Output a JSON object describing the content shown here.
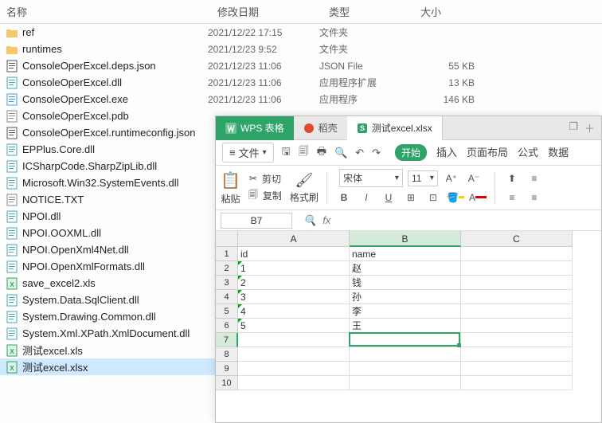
{
  "explorer": {
    "headers": {
      "name": "名称",
      "date": "修改日期",
      "type": "类型",
      "size": "大小"
    },
    "rows": [
      {
        "name": "ref",
        "date": "2021/12/22 17:15",
        "type": "文件夹",
        "size": "",
        "icon": "folder"
      },
      {
        "name": "runtimes",
        "date": "2021/12/23 9:52",
        "type": "文件夹",
        "size": "",
        "icon": "folder"
      },
      {
        "name": "ConsoleOperExcel.deps.json",
        "date": "2021/12/23 11:06",
        "type": "JSON File",
        "size": "55 KB",
        "icon": "json"
      },
      {
        "name": "ConsoleOperExcel.dll",
        "date": "2021/12/23 11:06",
        "type": "应用程序扩展",
        "size": "13 KB",
        "icon": "dll"
      },
      {
        "name": "ConsoleOperExcel.exe",
        "date": "2021/12/23 11:06",
        "type": "应用程序",
        "size": "146 KB",
        "icon": "exe"
      },
      {
        "name": "ConsoleOperExcel.pdb",
        "date": "",
        "type": "",
        "size": "",
        "icon": "file"
      },
      {
        "name": "ConsoleOperExcel.runtimeconfig.json",
        "date": "",
        "type": "",
        "size": "",
        "icon": "json"
      },
      {
        "name": "EPPlus.Core.dll",
        "date": "",
        "type": "",
        "size": "",
        "icon": "dll"
      },
      {
        "name": "ICSharpCode.SharpZipLib.dll",
        "date": "",
        "type": "",
        "size": "",
        "icon": "dll"
      },
      {
        "name": "Microsoft.Win32.SystemEvents.dll",
        "date": "",
        "type": "",
        "size": "",
        "icon": "dll"
      },
      {
        "name": "NOTICE.TXT",
        "date": "",
        "type": "",
        "size": "",
        "icon": "txt"
      },
      {
        "name": "NPOI.dll",
        "date": "",
        "type": "",
        "size": "",
        "icon": "dll"
      },
      {
        "name": "NPOI.OOXML.dll",
        "date": "",
        "type": "",
        "size": "",
        "icon": "dll"
      },
      {
        "name": "NPOI.OpenXml4Net.dll",
        "date": "",
        "type": "",
        "size": "",
        "icon": "dll"
      },
      {
        "name": "NPOI.OpenXmlFormats.dll",
        "date": "",
        "type": "",
        "size": "",
        "icon": "dll"
      },
      {
        "name": "save_excel2.xls",
        "date": "",
        "type": "",
        "size": "",
        "icon": "xls"
      },
      {
        "name": "System.Data.SqlClient.dll",
        "date": "",
        "type": "",
        "size": "",
        "icon": "dll"
      },
      {
        "name": "System.Drawing.Common.dll",
        "date": "",
        "type": "",
        "size": "",
        "icon": "dll"
      },
      {
        "name": "System.Xml.XPath.XmlDocument.dll",
        "date": "",
        "type": "",
        "size": "",
        "icon": "dll"
      },
      {
        "name": "测试excel.xls",
        "date": "",
        "type": "",
        "size": "",
        "icon": "xls"
      },
      {
        "name": "测试excel.xlsx",
        "date": "",
        "type": "",
        "size": "",
        "icon": "xlsx",
        "selected": true
      }
    ]
  },
  "wps": {
    "tabs": {
      "app": "WPS 表格",
      "shell": "稻壳",
      "file": "测试excel.xlsx"
    },
    "menubar": {
      "file": "文件",
      "start": "开始",
      "insert": "插入",
      "layout": "页面布局",
      "formula": "公式",
      "data": "数据"
    },
    "toolbar": {
      "paste": "粘贴",
      "cut": "剪切",
      "copy": "复制",
      "format_painter": "格式刷",
      "font": "宋体",
      "size": "11"
    },
    "namebox": "B7",
    "fx": "fx",
    "grid": {
      "cols": [
        "A",
        "B",
        "C"
      ],
      "rows": [
        "1",
        "2",
        "3",
        "4",
        "5",
        "6",
        "7",
        "8",
        "9",
        "10"
      ],
      "data": [
        [
          "id",
          "name",
          ""
        ],
        [
          "1",
          "赵",
          ""
        ],
        [
          "2",
          "钱",
          ""
        ],
        [
          "3",
          "孙",
          ""
        ],
        [
          "4",
          "李",
          ""
        ],
        [
          "5",
          "王",
          ""
        ],
        [
          "",
          "",
          ""
        ],
        [
          "",
          "",
          ""
        ],
        [
          "",
          "",
          ""
        ],
        [
          "",
          "",
          ""
        ]
      ],
      "active": {
        "row": 6,
        "col": 1
      }
    }
  }
}
